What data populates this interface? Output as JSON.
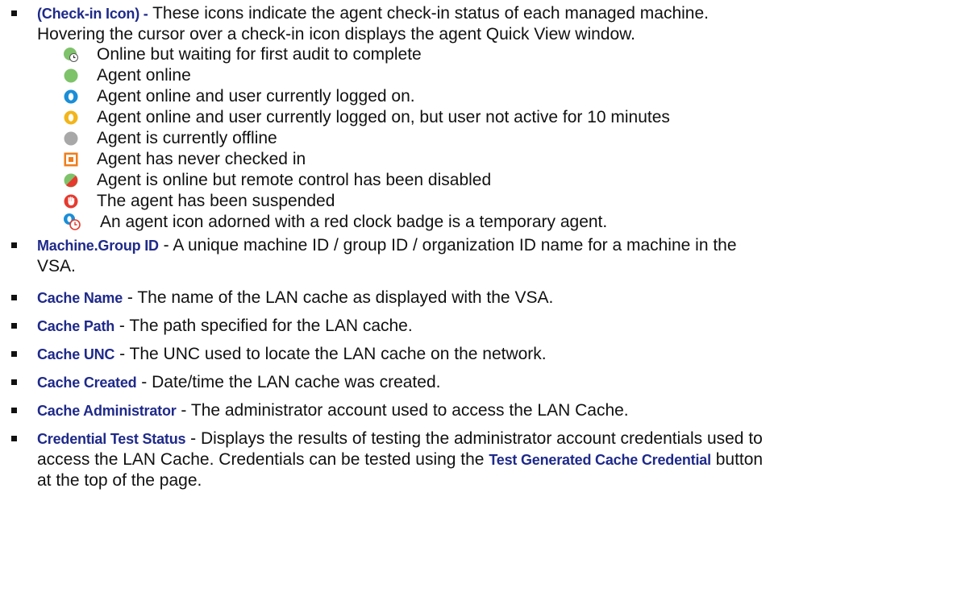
{
  "intro": {
    "term": "(Check-in Icon) -",
    "text_line1": " These icons indicate the agent check-in status of each managed machine.",
    "text_line2": "Hovering the cursor over a check-in icon displays the agent Quick View window."
  },
  "status_icons": [
    {
      "icon": "online-waiting-audit-icon",
      "label": "Online but waiting for first audit to complete"
    },
    {
      "icon": "agent-online-icon",
      "label": "Agent online"
    },
    {
      "icon": "user-logged-on-icon",
      "label": "Agent online and user currently logged on."
    },
    {
      "icon": "user-inactive-icon",
      "label": "Agent online and user currently logged on, but user not active for 10 minutes"
    },
    {
      "icon": "agent-offline-icon",
      "label": "Agent is currently offline"
    },
    {
      "icon": "never-checked-in-icon",
      "label": "Agent has never checked in"
    },
    {
      "icon": "remote-control-disabled-icon",
      "label": "Agent is online but remote control has been disabled"
    },
    {
      "icon": "agent-suspended-icon",
      "label": "The agent has been suspended"
    },
    {
      "icon": "temporary-agent-icon",
      "label": "An agent icon adorned with a red clock badge is a temporary agent."
    }
  ],
  "fields": [
    {
      "term": "Machine.Group ID",
      "line1": " - A unique machine ID / group ID / organization ID name for a machine in the",
      "line2": "VSA."
    },
    {
      "term": "Cache Name",
      "line1": " - The name of the LAN cache as displayed with the VSA."
    },
    {
      "term": "Cache Path",
      "line1": " - The path specified for the LAN cache."
    },
    {
      "term": "Cache UNC",
      "line1": " - The UNC used to locate the LAN cache on the network."
    },
    {
      "term": "Cache Created",
      "line1": " - Date/time the LAN cache was created."
    },
    {
      "term": "Cache Administrator",
      "line1": " - The administrator account used to access the LAN Cache."
    },
    {
      "term": "Credential Test Status",
      "line1": " - Displays the results of testing the administrator account credentials used to",
      "line2a": "access the LAN Cache. Credentials can be tested using the ",
      "button_term": "Test Generated Cache Credential",
      "line2b": " button",
      "line3": "at the top of the page."
    }
  ],
  "colors": {
    "term": "#1f2a8a",
    "online_green": "#7ec26a",
    "user_blue": "#1a8ed8",
    "user_yellow": "#f2b51a",
    "offline_gray": "#a8a8a8",
    "never_orange": "#f07d1a",
    "suspended_red": "#e63a2e"
  }
}
